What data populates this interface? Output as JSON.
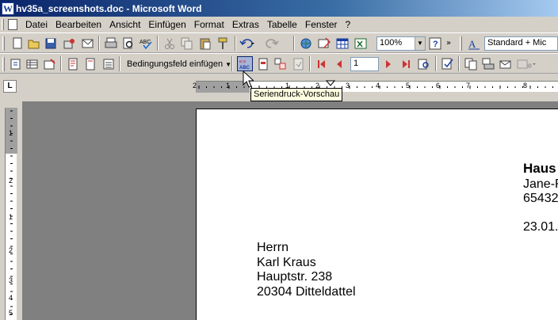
{
  "window": {
    "title": "hv35a_screenshots.doc - Microsoft Word",
    "app_icon": "W"
  },
  "menu": [
    "Datei",
    "Bearbeiten",
    "Ansicht",
    "Einfügen",
    "Format",
    "Extras",
    "Tabelle",
    "Fenster",
    "?"
  ],
  "toolbar_standard": {
    "zoom": "100%",
    "style": "Standard + Mic"
  },
  "toolbar_mailmerge": {
    "insert_field_label": "Bedingungsfeld einfügen",
    "record_number": "1"
  },
  "tooltip": "Seriendruck-Vorschau",
  "ruler": {
    "numbers": [
      "2",
      "1",
      "1",
      "2",
      "3",
      "4",
      "5",
      "6",
      "7",
      "8"
    ],
    "vertical_numbers": [
      "1",
      "2",
      "1",
      "2",
      "3",
      "4",
      "5"
    ]
  },
  "document": {
    "sender_name": "Haus",
    "sender_street": "Jane-R",
    "sender_city": "65432",
    "date": "23.01.",
    "recipient": {
      "salutation": "Herrn",
      "name": "Karl Kraus",
      "street": "Hauptstr. 238",
      "city": "20304 Ditteldattel"
    }
  },
  "icons": [
    "word-app-icon",
    "new-doc-icon",
    "open-icon",
    "save-icon",
    "permission-icon",
    "email-icon",
    "print-icon",
    "print-preview-icon",
    "spellcheck-icon",
    "cut-icon",
    "copy-icon",
    "paste-icon",
    "format-painter-icon",
    "undo-icon",
    "redo-icon",
    "hyperlink-icon",
    "tables-borders-icon",
    "insert-table-icon",
    "insert-excel-icon",
    "help-icon",
    "styles-icon",
    "mailmerge-preview-icon",
    "first-record-icon",
    "previous-record-icon",
    "next-record-icon",
    "last-record-icon",
    "find-entry-icon"
  ]
}
